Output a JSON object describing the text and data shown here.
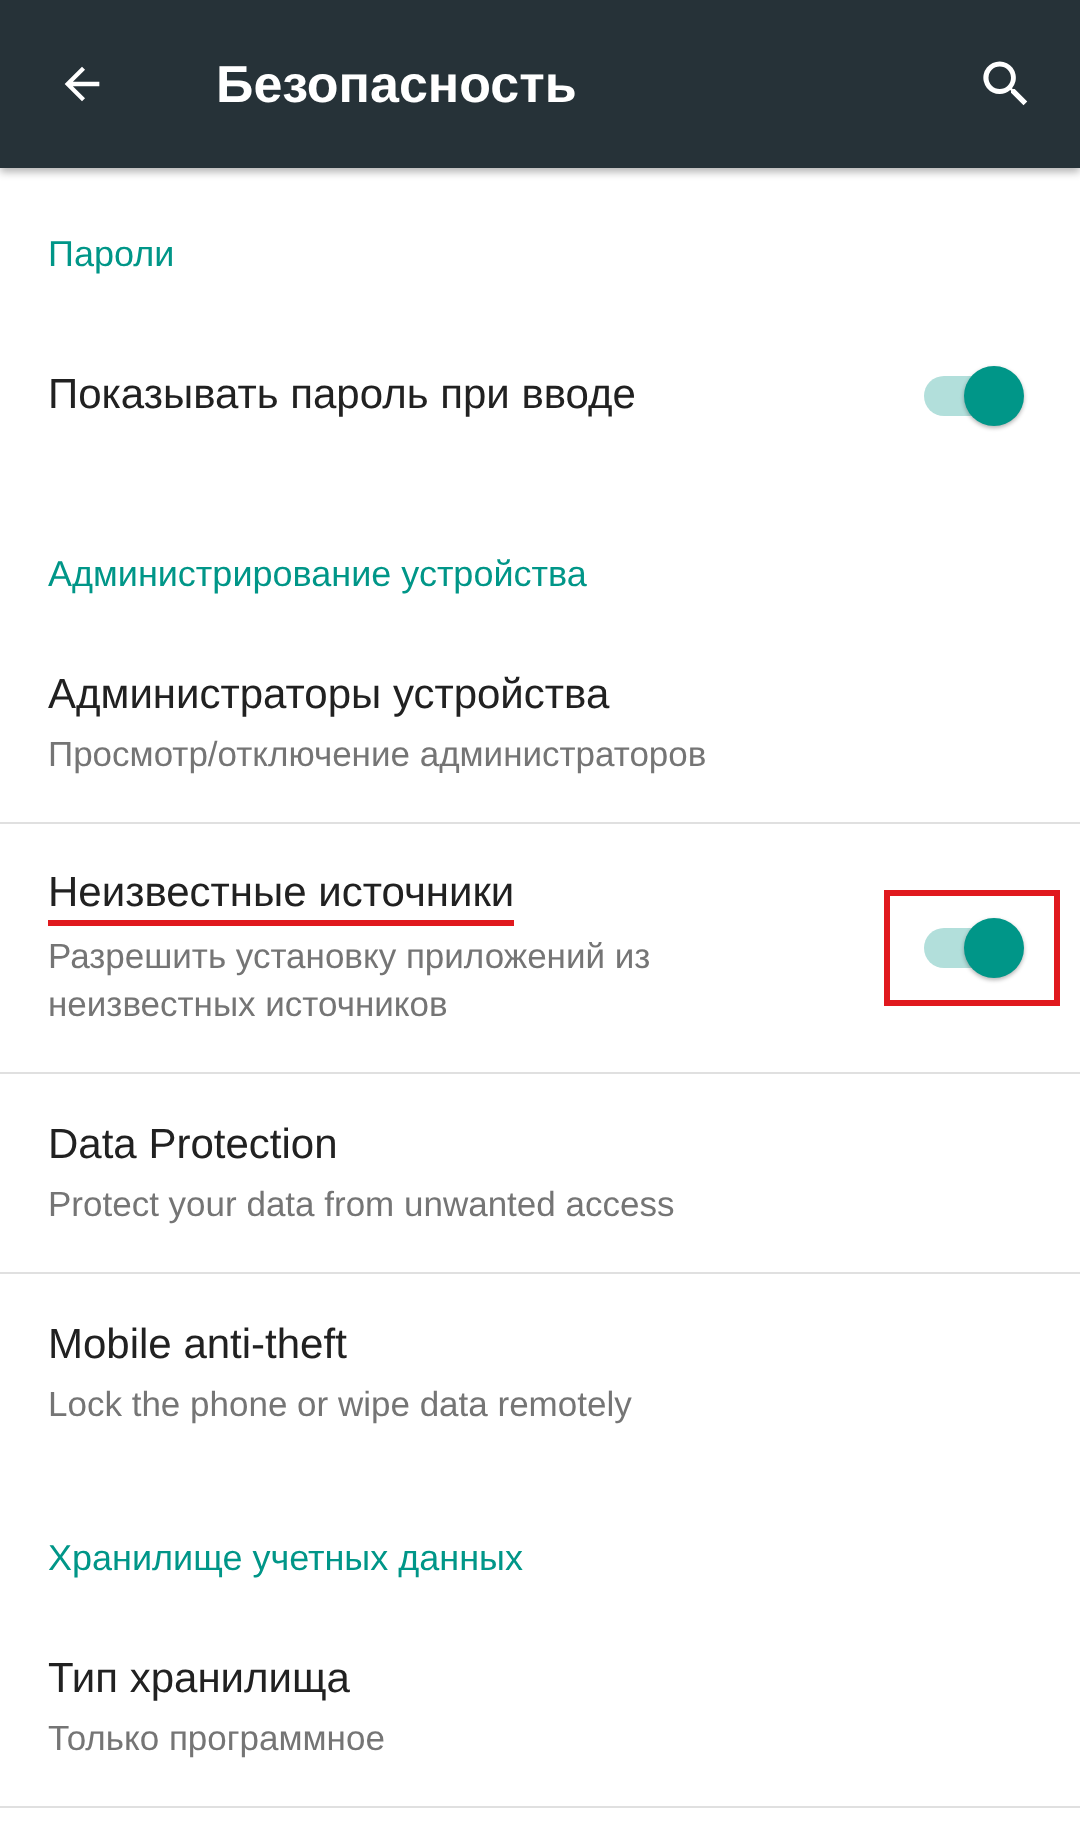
{
  "app_bar": {
    "title": "Безопасность"
  },
  "items": [
    {
      "kind": "header",
      "title": "Пароли"
    },
    {
      "kind": "setting",
      "title": "Показывать пароль при вводе",
      "toggle": {
        "on": true
      },
      "divider": false,
      "highlighted": false
    },
    {
      "kind": "header",
      "title": "Администрирование устройства"
    },
    {
      "kind": "setting",
      "title": "Администраторы устройства",
      "summary": "Просмотр/отключение администраторов",
      "divider": true,
      "highlighted": false
    },
    {
      "kind": "setting",
      "title": "Неизвестные источники",
      "summary": "Разрешить установку приложений из неизвестных источников",
      "toggle": {
        "on": true
      },
      "divider": true,
      "highlighted": true
    },
    {
      "kind": "setting",
      "title": "Data Protection",
      "summary": "Protect your data from unwanted access",
      "divider": true,
      "highlighted": false
    },
    {
      "kind": "setting",
      "title": "Mobile anti-theft",
      "summary": "Lock the phone or wipe data remotely",
      "divider": false,
      "highlighted": false
    },
    {
      "kind": "header",
      "title": "Хранилище учетных данных"
    },
    {
      "kind": "setting",
      "title": "Тип хранилища",
      "summary": "Только программное",
      "divider": true,
      "highlighted": false
    }
  ]
}
